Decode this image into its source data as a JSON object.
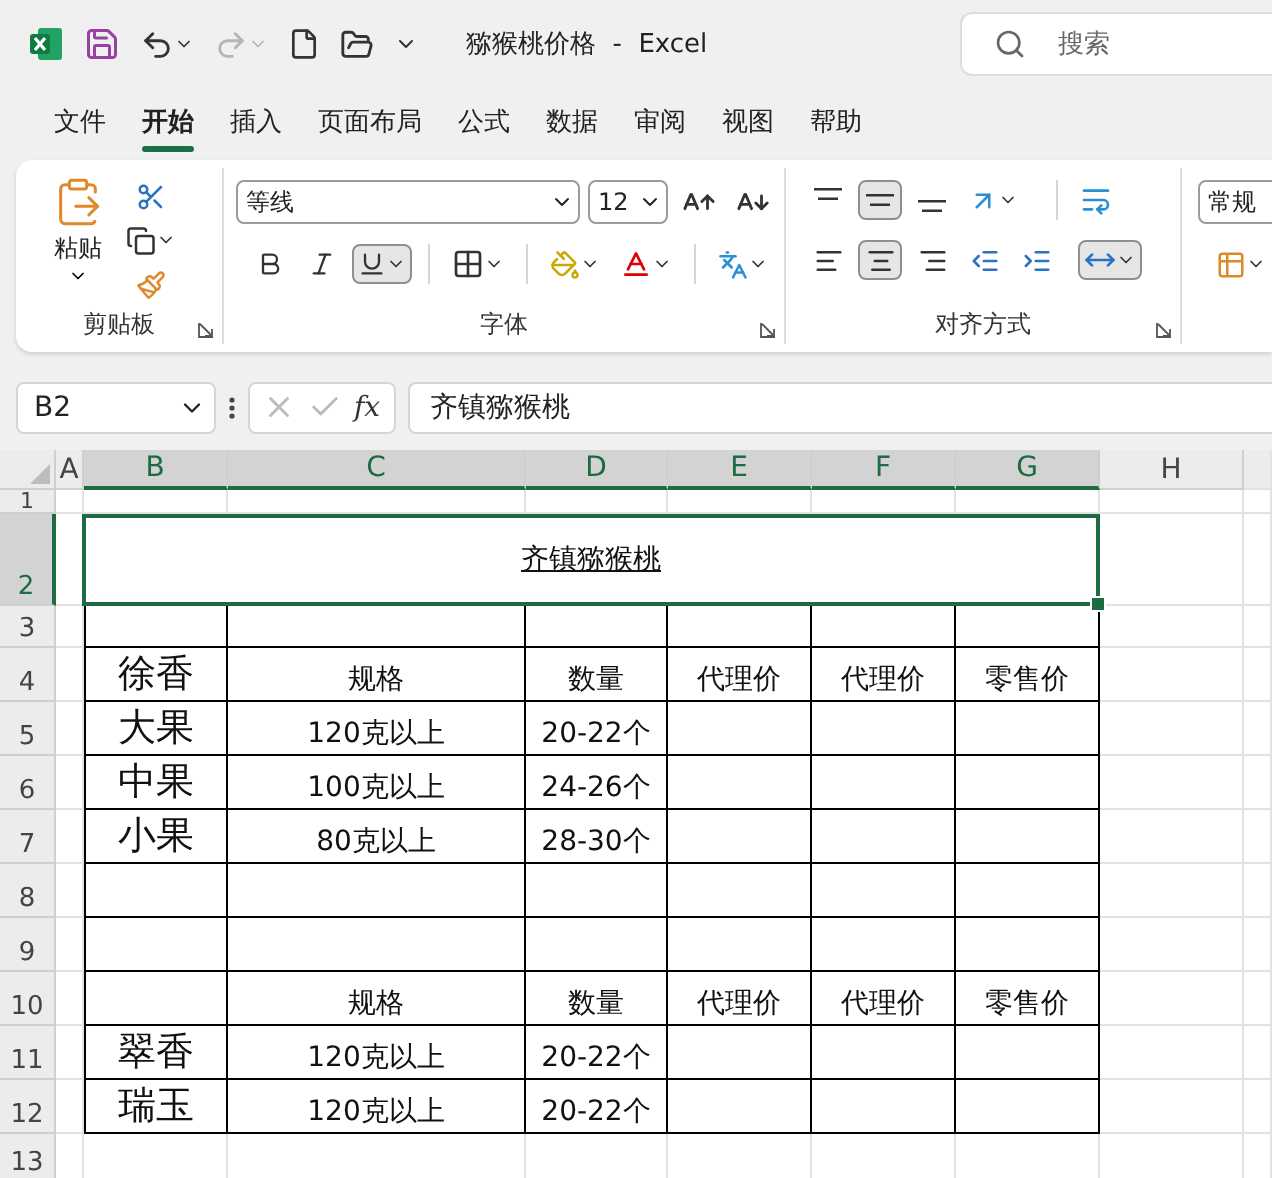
{
  "title_bar": {
    "title": "猕猴桃价格  -  Excel",
    "redo_disabled": true,
    "search": {
      "placeholder": "搜索"
    }
  },
  "menu_tabs": [
    {
      "label": "文件",
      "selected": false
    },
    {
      "label": "开始",
      "selected": true
    },
    {
      "label": "插入",
      "selected": false
    },
    {
      "label": "页面布局",
      "selected": false
    },
    {
      "label": "公式",
      "selected": false
    },
    {
      "label": "数据",
      "selected": false
    },
    {
      "label": "审阅",
      "selected": false
    },
    {
      "label": "视图",
      "selected": false
    },
    {
      "label": "帮助",
      "selected": false
    }
  ],
  "ribbon": {
    "clipboard": {
      "paste_label": "粘贴",
      "group_label": "剪贴板"
    },
    "font": {
      "font_name": "等线",
      "font_size": "12",
      "underline_pressed": true,
      "group_label": "字体"
    },
    "alignment": {
      "middle_align_pressed": true,
      "center_pressed": true,
      "merge_pressed": true,
      "group_label": "对齐方式"
    },
    "number": {
      "format": "常规"
    }
  },
  "formula_bar": {
    "name_box": "B2",
    "function_symbol": "fx",
    "formula": "齐镇猕猴桃"
  },
  "sheet": {
    "columns": [
      {
        "label": "A",
        "selected": false
      },
      {
        "label": "B",
        "selected": true
      },
      {
        "label": "C",
        "selected": true
      },
      {
        "label": "D",
        "selected": true
      },
      {
        "label": "E",
        "selected": true
      },
      {
        "label": "F",
        "selected": true
      },
      {
        "label": "G",
        "selected": true
      },
      {
        "label": "H",
        "selected": false
      }
    ],
    "rows": [
      {
        "label": "1",
        "selected": false
      },
      {
        "label": "2",
        "selected": true,
        "title": "齐镇猕猴桃"
      },
      {
        "label": "3",
        "selected": false,
        "cells": [
          null,
          null,
          null,
          null,
          null,
          null
        ]
      },
      {
        "label": "4",
        "selected": false,
        "cells": [
          "徐香",
          "规格",
          "数量",
          "代理价",
          "代理价",
          "零售价"
        ]
      },
      {
        "label": "5",
        "selected": false,
        "cells": [
          "大果",
          "120克以上",
          "20-22个",
          null,
          null,
          null
        ]
      },
      {
        "label": "6",
        "selected": false,
        "cells": [
          "中果",
          "100克以上",
          "24-26个",
          null,
          null,
          null
        ]
      },
      {
        "label": "7",
        "selected": false,
        "cells": [
          "小果",
          "80克以上",
          "28-30个",
          null,
          null,
          null
        ]
      },
      {
        "label": "8",
        "selected": false,
        "cells": [
          null,
          null,
          null,
          null,
          null,
          null
        ]
      },
      {
        "label": "9",
        "selected": false,
        "cells": [
          null,
          null,
          null,
          null,
          null,
          null
        ]
      },
      {
        "label": "10",
        "selected": false,
        "cells": [
          null,
          "规格",
          "数量",
          "代理价",
          "代理价",
          "零售价"
        ]
      },
      {
        "label": "11",
        "selected": false,
        "cells": [
          "翠香",
          "120克以上",
          "20-22个",
          null,
          null,
          null
        ]
      },
      {
        "label": "12",
        "selected": false,
        "cells": [
          "瑞玉",
          "120克以上",
          "20-22个",
          null,
          null,
          null
        ]
      },
      {
        "label": "13",
        "selected": false
      }
    ]
  }
}
